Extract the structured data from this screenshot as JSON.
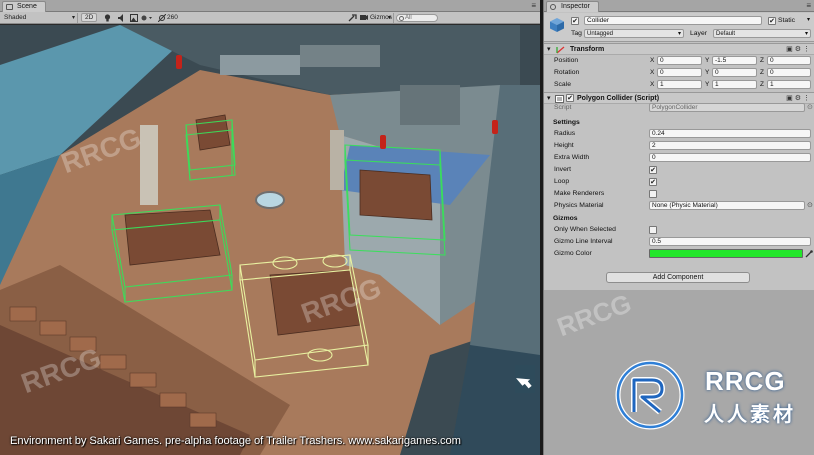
{
  "scene": {
    "tab_label": "Scene",
    "toolbar": {
      "shading_mode": "Shaded",
      "view_2d": "2D",
      "gizmos_label": "Gizmos",
      "layer_count": "260",
      "search_placeholder": "All"
    }
  },
  "caption": "Environment by Sakari Games. pre-alpha footage of Trailer Trashers. www.sakarigames.com",
  "inspector": {
    "tab_label": "Inspector",
    "gameobject": {
      "active": true,
      "name": "Collider",
      "static_label": "Static",
      "static": true,
      "tag_label": "Tag",
      "tag_value": "Untagged",
      "layer_label": "Layer",
      "layer_value": "Default"
    },
    "transform": {
      "title": "Transform",
      "position_label": "Position",
      "rotation_label": "Rotation",
      "scale_label": "Scale",
      "position": {
        "x": "0",
        "y": "-1.5",
        "z": "0"
      },
      "rotation": {
        "x": "0",
        "y": "0",
        "z": "0"
      },
      "scale": {
        "x": "1",
        "y": "1",
        "z": "1"
      }
    },
    "polygon_collider": {
      "title": "Polygon Collider (Script)",
      "script_label": "Script",
      "script_value": "PolygonCollider",
      "settings_label": "Settings",
      "radius_label": "Radius",
      "radius": "0.24",
      "height_label": "Height",
      "height": "2",
      "extra_width_label": "Extra Width",
      "extra_width": "0",
      "invert_label": "Invert",
      "invert": true,
      "loop_label": "Loop",
      "loop": true,
      "make_renderers_label": "Make Renderers",
      "make_renderers": false,
      "physics_material_label": "Physics Material",
      "physics_material": "None (Physic Material)",
      "gizmos_label": "Gizmos",
      "only_when_selected_label": "Only When Selected",
      "only_when_selected": false,
      "gizmo_line_interval_label": "Gizmo Line Interval",
      "gizmo_line_interval": "0.5",
      "gizmo_color_label": "Gizmo Color",
      "gizmo_color": "#22e62a"
    },
    "add_component_label": "Add Component"
  },
  "logo": {
    "line1": "RRCG",
    "line2": "人人素材"
  },
  "watermark_text": "RRCG",
  "colors": {
    "collider_green": "#39e05a",
    "floor": "#a87a5c",
    "inspector_bg": "#c2c2c2"
  }
}
